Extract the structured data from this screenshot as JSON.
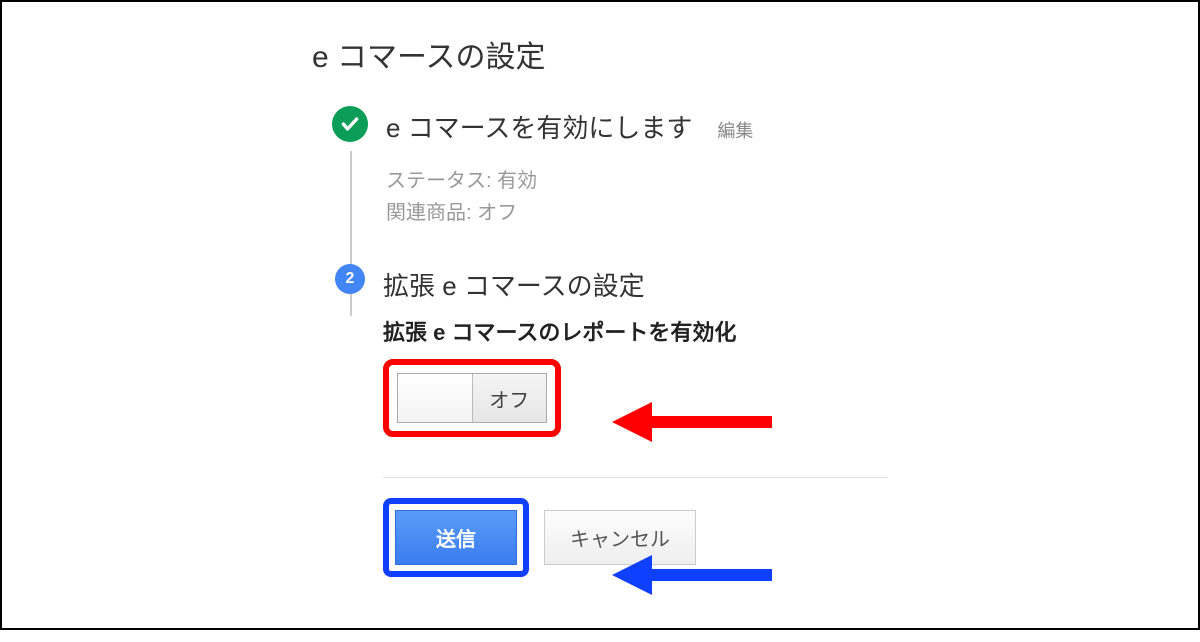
{
  "page": {
    "title": "e コマースの設定"
  },
  "step1": {
    "title": "e コマースを有効にします",
    "edit_label": "編集",
    "status_label": "ステータス:",
    "status_value": "有効",
    "related_label": "関連商品:",
    "related_value": "オフ"
  },
  "step2": {
    "number": "2",
    "title": "拡張 e コマースの設定",
    "subtitle": "拡張 e コマースのレポートを有効化",
    "toggle_off": "オフ"
  },
  "actions": {
    "submit": "送信",
    "cancel": "キャンセル"
  },
  "colors": {
    "highlight_red": "#f00",
    "highlight_blue": "#1040ff",
    "success_green": "#0c9d58",
    "primary_blue": "#4285f4"
  }
}
